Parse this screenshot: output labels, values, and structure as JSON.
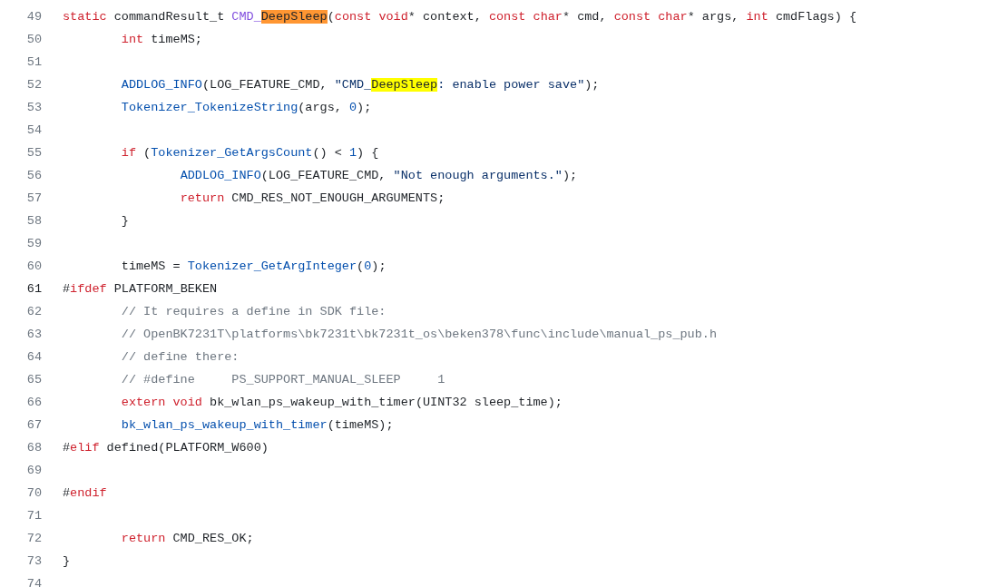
{
  "code_lines": [
    {
      "number": "49",
      "current": false,
      "tokens": [
        {
          "kind": "keyword",
          "text": "static"
        },
        {
          "kind": "plain",
          "text": " commandResult_t "
        },
        {
          "kind": "entity",
          "text": "CMD_"
        },
        {
          "text": "DeepSleep",
          "highlighted": true,
          "focused": true
        },
        {
          "kind": "plain",
          "text": "("
        },
        {
          "kind": "keyword",
          "text": "const void"
        },
        {
          "kind": "plain",
          "text": "* context, "
        },
        {
          "kind": "keyword",
          "text": "const char"
        },
        {
          "kind": "plain",
          "text": "* cmd, "
        },
        {
          "kind": "keyword",
          "text": "const char"
        },
        {
          "kind": "plain",
          "text": "* args, "
        },
        {
          "kind": "keyword",
          "text": "int"
        },
        {
          "kind": "plain",
          "text": " cmdFlags) {"
        }
      ]
    },
    {
      "number": "50",
      "current": false,
      "tokens": [
        {
          "kind": "keyword",
          "text": "\tint"
        },
        {
          "kind": "plain",
          "text": " timeMS;"
        }
      ]
    },
    {
      "number": "51",
      "current": false
    },
    {
      "number": "52",
      "current": false,
      "tokens": [
        {
          "kind": "call",
          "text": "\tADDLOG_INFO"
        },
        {
          "kind": "plain",
          "text": "(LOG_FEATURE_CMD, "
        },
        {
          "kind": "string",
          "text": "\"CMD_"
        },
        {
          "text": "DeepSleep",
          "highlighted": true,
          "focused": false
        },
        {
          "kind": "string",
          "text": ": enable power save\""
        },
        {
          "kind": "plain",
          "text": ");"
        }
      ]
    },
    {
      "number": "53",
      "current": false,
      "tokens": [
        {
          "kind": "call",
          "text": "\tTokenizer_TokenizeString"
        },
        {
          "kind": "plain",
          "text": "(args, "
        },
        {
          "kind": "number",
          "text": "0"
        },
        {
          "kind": "plain",
          "text": ");"
        }
      ]
    },
    {
      "number": "54",
      "current": false
    },
    {
      "number": "55",
      "current": false,
      "tokens": [
        {
          "kind": "keyword",
          "text": "\tif"
        },
        {
          "kind": "plain",
          "text": " ("
        },
        {
          "kind": "call",
          "text": "Tokenizer_GetArgsCount"
        },
        {
          "kind": "plain",
          "text": "() < "
        },
        {
          "kind": "number",
          "text": "1"
        },
        {
          "kind": "plain",
          "text": ") {"
        }
      ]
    },
    {
      "number": "56",
      "current": false,
      "tokens": [
        {
          "kind": "call",
          "text": "\t\tADDLOG_INFO"
        },
        {
          "kind": "plain",
          "text": "(LOG_FEATURE_CMD, "
        },
        {
          "kind": "string",
          "text": "\"Not enough arguments.\""
        },
        {
          "kind": "plain",
          "text": ");"
        }
      ]
    },
    {
      "number": "57",
      "current": false,
      "tokens": [
        {
          "kind": "keyword",
          "text": "\t\treturn"
        },
        {
          "kind": "plain",
          "text": " CMD_RES_NOT_ENOUGH_ARGUMENTS;"
        }
      ]
    },
    {
      "number": "58",
      "current": false,
      "tokens": [
        {
          "kind": "plain",
          "text": "\t}"
        }
      ]
    },
    {
      "number": "59",
      "current": false
    },
    {
      "number": "60",
      "current": false,
      "tokens": [
        {
          "kind": "plain",
          "text": "\ttimeMS = "
        },
        {
          "kind": "call",
          "text": "Tokenizer_GetArgInteger"
        },
        {
          "kind": "plain",
          "text": "("
        },
        {
          "kind": "number",
          "text": "0"
        },
        {
          "kind": "plain",
          "text": ");"
        }
      ]
    },
    {
      "number": "61",
      "current": true,
      "tokens": [
        {
          "kind": "plain",
          "text": "#"
        },
        {
          "kind": "keyword",
          "text": "ifdef"
        },
        {
          "kind": "plain",
          "text": " PLATFORM_BEKEN"
        }
      ]
    },
    {
      "number": "62",
      "current": false,
      "tokens": [
        {
          "kind": "comment",
          "text": "\t// It requires a define in SDK file:"
        }
      ]
    },
    {
      "number": "63",
      "current": false,
      "tokens": [
        {
          "kind": "comment",
          "text": "\t// OpenBK7231T\\platforms\\bk7231t\\bk7231t_os\\beken378\\func\\include\\manual_ps_pub.h"
        }
      ]
    },
    {
      "number": "64",
      "current": false,
      "tokens": [
        {
          "kind": "comment",
          "text": "\t// define there:"
        }
      ]
    },
    {
      "number": "65",
      "current": false,
      "tokens": [
        {
          "kind": "comment",
          "text": "\t// #define     PS_SUPPORT_MANUAL_SLEEP     1"
        }
      ]
    },
    {
      "number": "66",
      "current": false,
      "tokens": [
        {
          "kind": "keyword",
          "text": "\textern void"
        },
        {
          "kind": "plain",
          "text": " bk_wlan_ps_wakeup_with_timer(UINT32 sleep_time);"
        }
      ]
    },
    {
      "number": "67",
      "current": false,
      "tokens": [
        {
          "kind": "call",
          "text": "\tbk_wlan_ps_wakeup_with_timer"
        },
        {
          "kind": "plain",
          "text": "(timeMS);"
        }
      ]
    },
    {
      "number": "68",
      "current": false,
      "tokens": [
        {
          "kind": "plain",
          "text": "#"
        },
        {
          "kind": "keyword",
          "text": "elif"
        },
        {
          "kind": "plain",
          "text": " defined(PLATFORM_W600)"
        }
      ]
    },
    {
      "number": "69",
      "current": false
    },
    {
      "number": "70",
      "current": false,
      "tokens": [
        {
          "kind": "plain",
          "text": "#"
        },
        {
          "kind": "keyword",
          "text": "endif"
        }
      ]
    },
    {
      "number": "71",
      "current": false
    },
    {
      "number": "72",
      "current": false,
      "tokens": [
        {
          "kind": "keyword",
          "text": "\treturn"
        },
        {
          "kind": "plain",
          "text": " CMD_RES_OK;"
        }
      ]
    },
    {
      "number": "73",
      "current": false,
      "tokens": [
        {
          "kind": "plain",
          "text": "}"
        }
      ]
    },
    {
      "number": "74",
      "current": false
    }
  ]
}
